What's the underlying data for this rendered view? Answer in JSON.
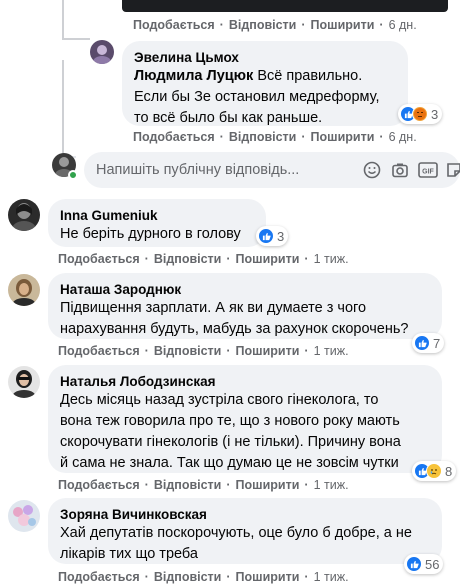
{
  "labels": {
    "like": "Подобається",
    "reply": "Відповісти",
    "share": "Поширити",
    "sep": "·"
  },
  "top_actions": {
    "time": "6 дн."
  },
  "comments": [
    {
      "author": "Эвелина Цьмох",
      "mention": "Людмила Луцюк",
      "text_line1": " Всё правильно.",
      "text_line2": "Если бы Зе остановил медреформу,",
      "text_line3": "то всё было бы как раньше.",
      "time": "6 дн.",
      "reaction_count": "3",
      "reaction_icons": [
        "like-icon",
        "angry-icon"
      ]
    },
    {
      "author": "Inna Gumeniuk",
      "text_line1": "Не беріть дурного в голову",
      "time": "1 тиж.",
      "reaction_count": "3",
      "reaction_icons": [
        "like-icon"
      ]
    },
    {
      "author": "Наташа Зароднюк",
      "text_line1": "Підвищення зарплати. А як ви думаете з чого",
      "text_line2": "нарахування будуть, мабудь за рахунок скорочень?",
      "time": "1 тиж.",
      "reaction_count": "7",
      "reaction_icons": [
        "like-icon"
      ]
    },
    {
      "author": "Наталья Лободзинская",
      "text_line1": "Десь місяць назад зустріла свого гінеколога, то",
      "text_line2": "вона теж говорила про те, що з нового року мають",
      "text_line3": "скорочувати гінекологів (і не тільки). Причину вона",
      "text_line4": "й сама не знала. Так що думаю це не зовсім чутки",
      "time": "1 тиж.",
      "reaction_count": "8",
      "reaction_icons": [
        "like-icon",
        "sad-icon"
      ]
    },
    {
      "author": "Зоряна Вичинковская",
      "text_line1": "Хай депутатів поскорочують, оце було б добре, а не",
      "text_line2": "лікарів тих що треба",
      "time": "1 тиж.",
      "reaction_count": "56",
      "reaction_icons": [
        "like-icon"
      ]
    }
  ],
  "reply_box": {
    "placeholder": "Напишіть публічну відповідь..."
  },
  "colors": {
    "bubble": "#f0f2f5",
    "meta": "#65676b",
    "like": "#1877f2",
    "online": "#31a24c"
  }
}
